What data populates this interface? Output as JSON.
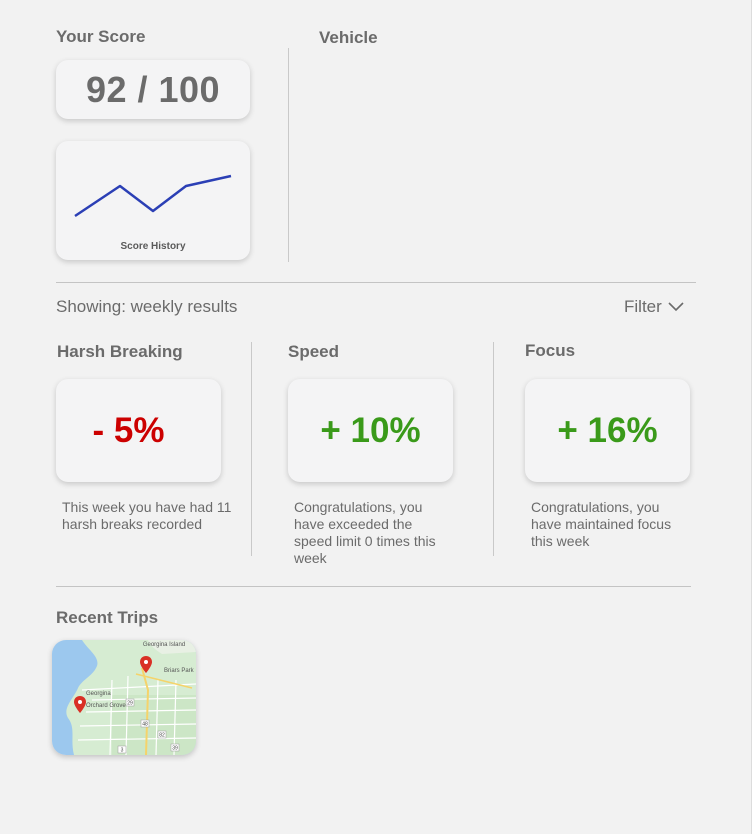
{
  "score": {
    "title": "Your Score",
    "value": "92 / 100",
    "history_caption": "Score History",
    "line_color": "#2b3fb5"
  },
  "vehicle": {
    "title": "Vehicle"
  },
  "results": {
    "showing_label": "Showing: weekly results",
    "filter_label": "Filter"
  },
  "metrics": [
    {
      "title": "Harsh Breaking",
      "value": "- 5%",
      "color": "#cc0000",
      "description": "This week you have had 11 harsh breaks recorded"
    },
    {
      "title": "Speed",
      "value": "+ 10%",
      "color": "#3a9a1a",
      "description": "Congratulations, you have exceeded the speed limit 0 times this week"
    },
    {
      "title": "Focus",
      "value": "+ 16%",
      "color": "#3a9a1a",
      "description": "Congratulations, you have maintained focus this week"
    }
  ],
  "recent_trips": {
    "title": "Recent Trips",
    "map": {
      "labels": [
        "Georgina Island",
        "Briars Park",
        "Georgina",
        "Orchard Grove"
      ],
      "road_numbers": [
        "29",
        "48",
        "82",
        "3",
        "39"
      ]
    }
  }
}
